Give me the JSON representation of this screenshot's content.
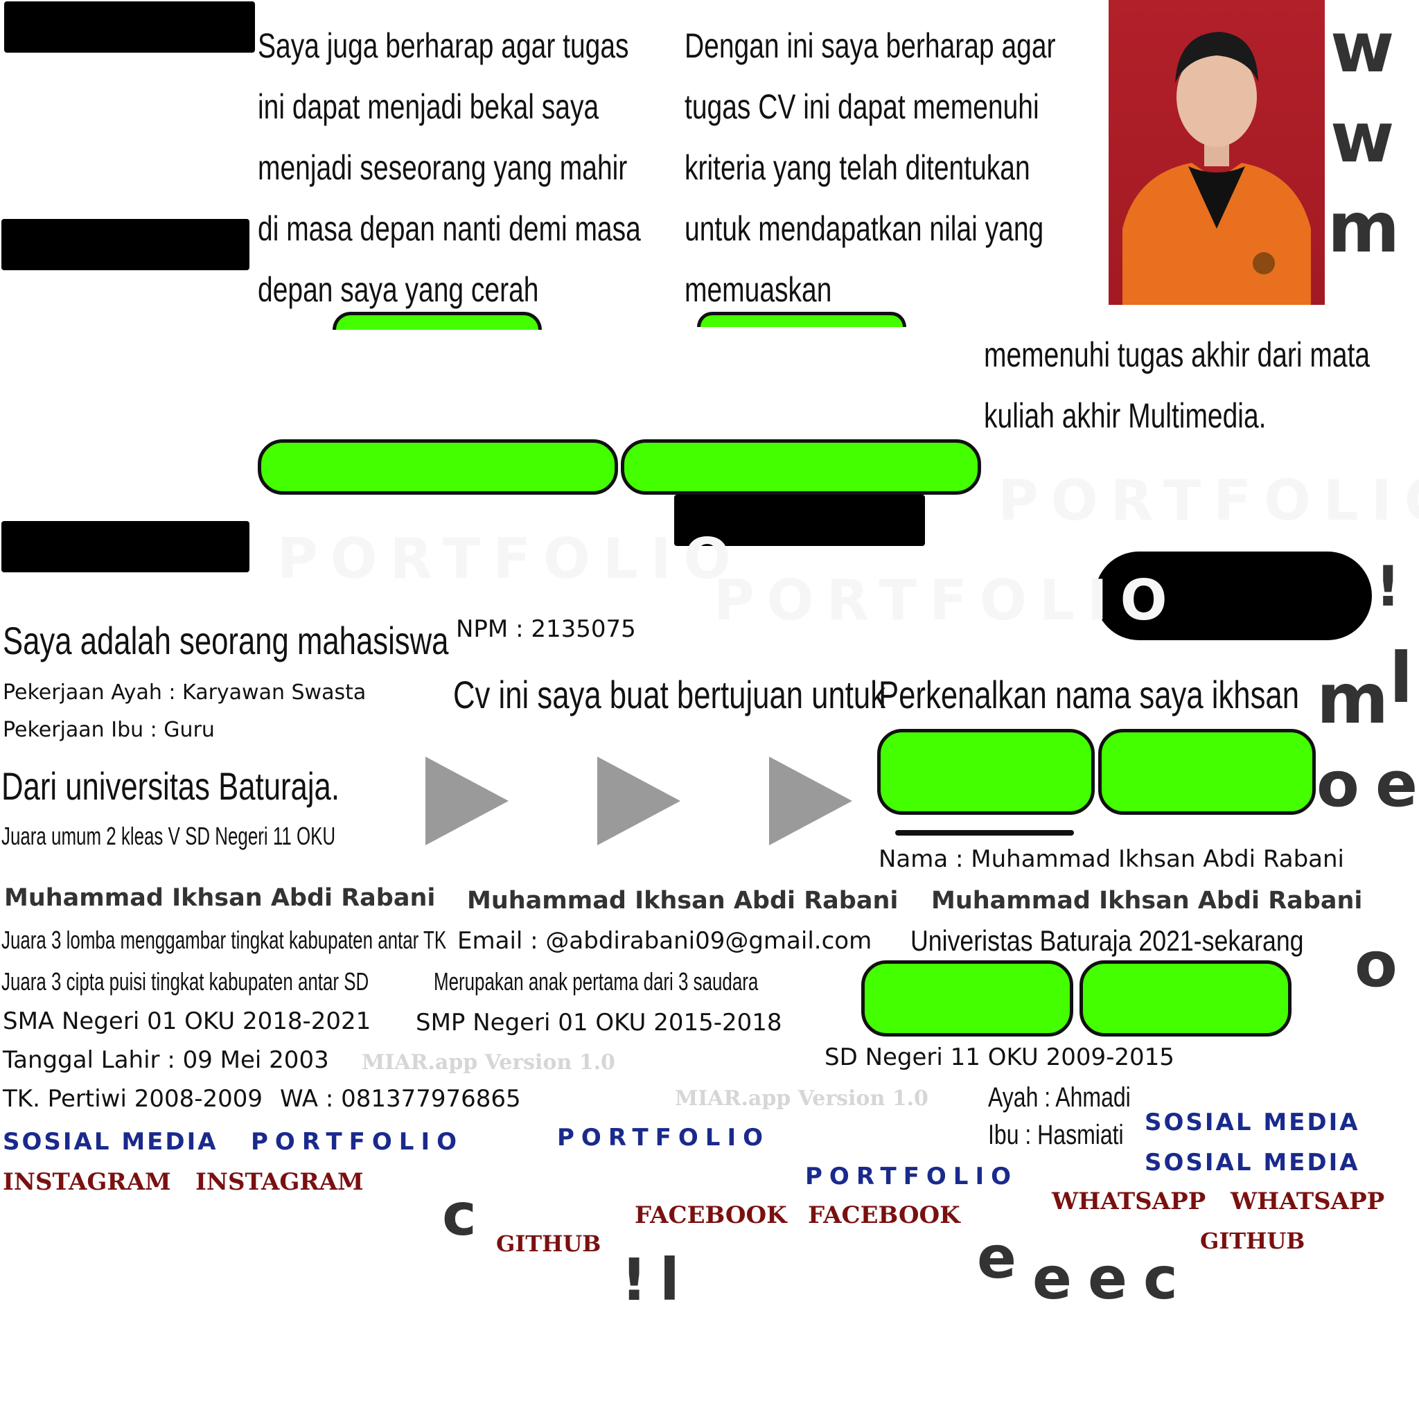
{
  "paragraphs": {
    "harap_bekal": [
      "Saya juga berharap agar tugas",
      "ini dapat menjadi bekal saya",
      "menjadi seseorang yang mahir",
      "di masa depan nanti demi masa",
      "depan saya yang cerah"
    ],
    "harap_cv": [
      "Dengan ini saya berharap agar",
      "tugas CV ini dapat memenuhi",
      "kriteria yang telah ditentukan",
      "untuk mendapatkan nilai yang",
      "memuaskan"
    ],
    "tugas_akhir": [
      "memenuhi tugas akhir dari mata",
      "kuliah akhir Multimedia."
    ]
  },
  "intro": {
    "mahasiswa": "Saya adalah seorang mahasiswa",
    "universitas": "Dari universitas Baturaja.",
    "tujuan": "Cv ini saya buat bertujuan untuk",
    "perkenalan": "Perkenalkan nama saya ikhsan"
  },
  "info": {
    "npm": "NPM : 2135075",
    "pekerjaan_ayah": "Pekerjaan Ayah : Karyawan Swasta",
    "pekerjaan_ibu": "Pekerjaan Ibu : Guru",
    "nama": "Nama : Muhammad Ikhsan Abdi Rabani",
    "email": "Email : @abdirabani09@gmail.com",
    "anak": "Merupakan anak pertama dari 3 saudara",
    "tanggal_lahir": "Tanggal Lahir : 09 Mei 2003",
    "wa": "WA : 081377976865",
    "ayah": "Ayah : Ahmadi",
    "ibu": "Ibu : Hasmiati"
  },
  "achievements": {
    "juara_umum": "Juara umum 2 kleas V SD Negeri 11 OKU",
    "juara_menggambar": "Juara 3 lomba menggambar tingkat kabupaten antar TK",
    "juara_puisi": "Juara 3 cipta puisi tingkat kabupaten antar SD"
  },
  "education": {
    "universitas": "Univeristas Baturaja 2021-sekarang",
    "sma": "SMA Negeri 01 OKU 2018-2021",
    "smp": "SMP Negeri 01 OKU 2015-2018",
    "sd": "SD Negeri 11 OKU 2009-2015",
    "tk": "TK. Pertiwi 2008-2009"
  },
  "name_banner": "Muhammad Ikhsan Abdi Rabani",
  "watermark": "MIAR.app Version 1.0",
  "labels": {
    "sosial_media": "SOSIAL MEDIA",
    "portfolio": "PORTFOLIO",
    "instagram": "INSTAGRAM",
    "facebook": "FACEBOOK",
    "whatsapp": "WHATSAPP",
    "github": "GITHUB"
  },
  "letters": {
    "w": "w",
    "m": "m",
    "excl": "!",
    "l": "l",
    "o": "o",
    "e": "e",
    "c": "c"
  },
  "colors": {
    "green": "#44ff00",
    "navy": "#1a2a8c",
    "maroon": "#7a1010",
    "gray": "#9a9a9a"
  }
}
